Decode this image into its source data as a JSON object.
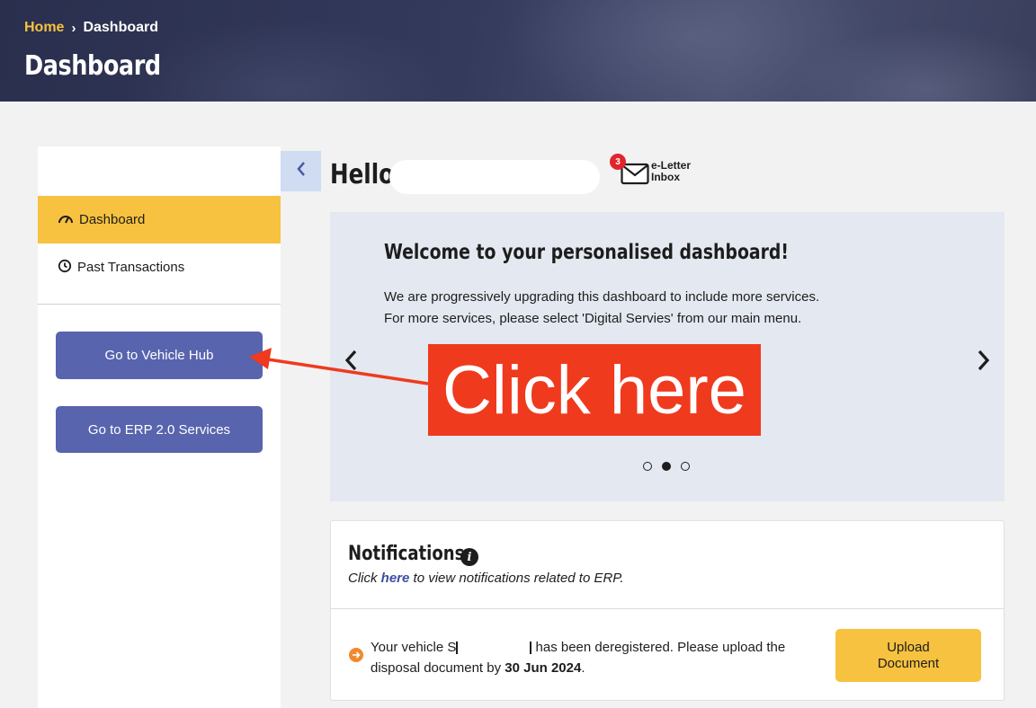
{
  "header": {
    "breadcrumb_home": "Home",
    "breadcrumb_separator": "›",
    "breadcrumb_current": "Dashboard",
    "title": "Dashboard"
  },
  "sidebar": {
    "items": [
      {
        "label": "Dashboard",
        "icon": "speedometer-icon",
        "active": true
      },
      {
        "label": "Past Transactions",
        "icon": "clock-icon",
        "active": false
      }
    ],
    "buttons": {
      "vehicle_hub": "Go to Vehicle Hub",
      "erp": "Go to ERP 2.0 Services"
    }
  },
  "greeting": {
    "hello": "Hello",
    "eletter_badge": "3",
    "eletter_label_1": "e-Letter",
    "eletter_label_2": "Inbox"
  },
  "carousel": {
    "title": "Welcome to your personalised dashboard!",
    "line1": "We are progressively upgrading this dashboard to include more services.",
    "line2": "For more services, please select 'Digital Servies' from our main menu.",
    "active_slide": 2,
    "slide_count": 3
  },
  "annotation": {
    "callout": "Click here",
    "color": "#ef3a1e"
  },
  "notifications": {
    "title": "Notifications",
    "subtitle_prefix": "Click ",
    "subtitle_link": "here",
    "subtitle_suffix": " to view notifications related to ERP.",
    "items": [
      {
        "text_before": "Your vehicle S",
        "text_after": " has been deregistered. Please upload the disposal document by ",
        "date": "30 Jun 2024",
        "end": ".",
        "action": "Upload Document"
      }
    ]
  },
  "colors": {
    "accent_yellow": "#f7c23f",
    "button_blue": "#5864ad",
    "link_blue": "#3d4f9f",
    "banner_navy": "#2a2f4e"
  }
}
